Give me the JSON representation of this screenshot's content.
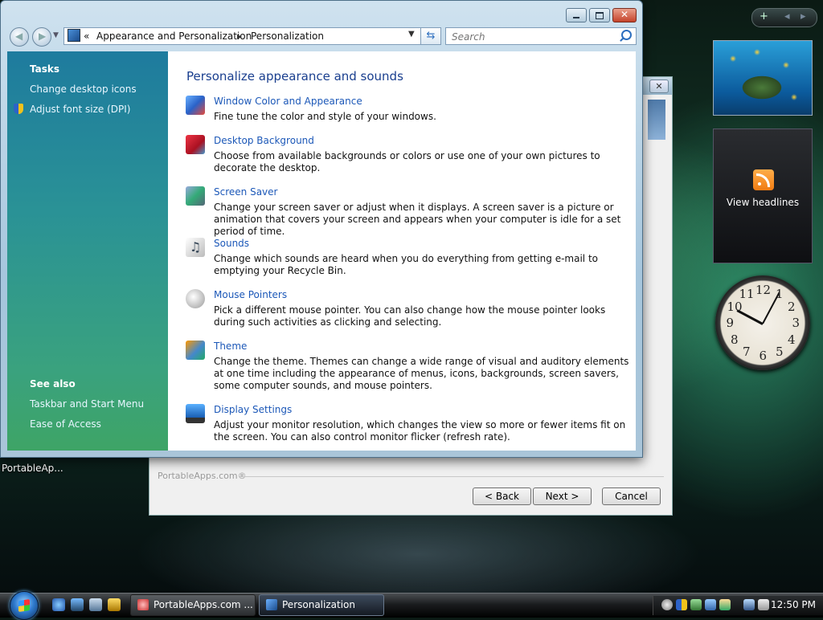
{
  "desktop": {
    "icon_label": "PortableAp..."
  },
  "sidebar": {
    "rss_label": "View headlines",
    "clock_numbers": [
      "12",
      "1",
      "2",
      "3",
      "4",
      "5",
      "6",
      "7",
      "8",
      "9",
      "10",
      "11"
    ]
  },
  "wizard": {
    "brand": "PortableApps.com®",
    "back": "< Back",
    "next": "Next >",
    "cancel": "Cancel"
  },
  "window": {
    "breadcrumb_chevron": "«",
    "breadcrumb": [
      "Appearance and Personalization",
      "Personalization"
    ],
    "search_placeholder": "Search",
    "tasks_heading": "Tasks",
    "tasks": [
      "Change desktop icons",
      "Adjust font size (DPI)"
    ],
    "see_also_heading": "See also",
    "see_also": [
      "Taskbar and Start Menu",
      "Ease of Access"
    ],
    "page_title": "Personalize appearance and sounds",
    "items": [
      {
        "label": "Window Color and Appearance",
        "desc": "Fine tune the color and style of your windows.",
        "icon": "window-color-icon"
      },
      {
        "label": "Desktop Background",
        "desc": "Choose from available backgrounds or colors or use one of your own pictures to decorate the desktop.",
        "icon": "desktop-background-icon"
      },
      {
        "label": "Screen Saver",
        "desc": "Change your screen saver or adjust when it displays. A screen saver is a picture or animation that covers your screen and appears when your computer is idle for a set period of time.",
        "icon": "screen-saver-icon"
      },
      {
        "label": "Sounds",
        "desc": "Change which sounds are heard when you do everything from getting e-mail to emptying your Recycle Bin.",
        "icon": "sounds-icon"
      },
      {
        "label": "Mouse Pointers",
        "desc": "Pick a different mouse pointer. You can also change how the mouse pointer looks during such activities as clicking and selecting.",
        "icon": "mouse-pointer-icon"
      },
      {
        "label": "Theme",
        "desc": "Change the theme. Themes can change a wide range of visual and auditory elements at one time including the appearance of menus, icons, backgrounds, screen savers, some computer sounds, and mouse pointers.",
        "icon": "theme-icon"
      },
      {
        "label": "Display Settings",
        "desc": "Adjust your monitor resolution, which changes the view so more or fewer items fit on the screen. You can also control monitor flicker (refresh rate).",
        "icon": "display-settings-icon"
      }
    ]
  },
  "taskbar": {
    "buttons": [
      "PortableApps.com ...",
      "Personalization"
    ],
    "time": "12:50 PM"
  }
}
